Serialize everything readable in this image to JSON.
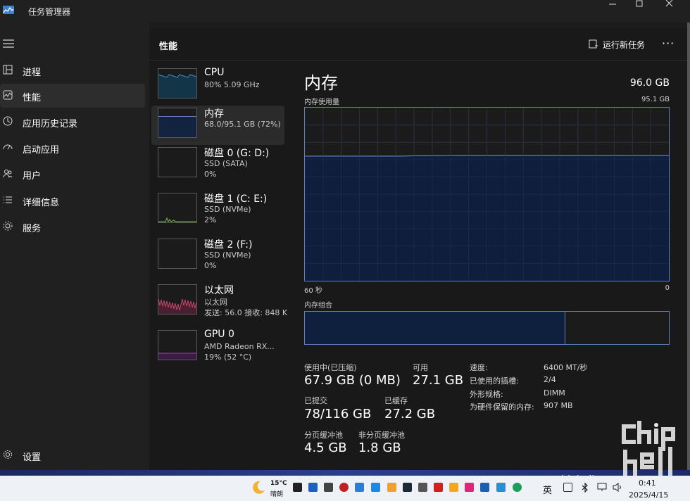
{
  "window": {
    "title": "任务管理器",
    "icons": [
      "app-icon",
      "minimize-icon",
      "maximize-icon",
      "close-icon"
    ]
  },
  "nav": {
    "items": [
      {
        "label": "进程",
        "icon": "processes-icon",
        "active": false
      },
      {
        "label": "性能",
        "icon": "performance-icon",
        "active": true
      },
      {
        "label": "应用历史记录",
        "icon": "app-history-icon",
        "active": false
      },
      {
        "label": "启动应用",
        "icon": "startup-icon",
        "active": false
      },
      {
        "label": "用户",
        "icon": "users-icon",
        "active": false
      },
      {
        "label": "详细信息",
        "icon": "details-icon",
        "active": false
      },
      {
        "label": "服务",
        "icon": "services-icon",
        "active": false
      }
    ],
    "settings_label": "设置"
  },
  "header": {
    "title": "性能",
    "run_task_label": "运行新任务",
    "more_label": "···"
  },
  "devices": [
    {
      "name": "CPU",
      "sub1": "80%  5.09 GHz",
      "sub2": "",
      "color": "#3a8fc7",
      "active": false
    },
    {
      "name": "内存",
      "sub1": "68.0/95.1 GB (72%)",
      "sub2": "",
      "color": "#5f7fbf",
      "active": true
    },
    {
      "name": "磁盘 0 (G: D:)",
      "sub1": "SSD (SATA)",
      "sub2": "0%",
      "color": "#6aa84f",
      "active": false
    },
    {
      "name": "磁盘 1 (C: E:)",
      "sub1": "SSD (NVMe)",
      "sub2": "2%",
      "color": "#6aa84f",
      "active": false
    },
    {
      "name": "磁盘 2 (F:)",
      "sub1": "SSD (NVMe)",
      "sub2": "0%",
      "color": "#6aa84f",
      "active": false
    },
    {
      "name": "以太网",
      "sub1": "以太网",
      "sub2": "发送: 56.0  接收: 848 K",
      "color": "#c04a6a",
      "active": false
    },
    {
      "name": "GPU 0",
      "sub1": "AMD Radeon RX...",
      "sub2": "19% (52 °C)",
      "color": "#9b3fb5",
      "active": false
    }
  ],
  "detail": {
    "title": "内存",
    "total": "96.0 GB",
    "usage_label": "内存使用量",
    "usage_max": "95.1 GB",
    "time_left": "60 秒",
    "time_right": "0",
    "composition_label": "内存组合",
    "composition_used_fraction": 0.715,
    "stats": {
      "in_use_label": "使用中(已压缩)",
      "in_use_value": "67.9 GB (0 MB)",
      "available_label": "可用",
      "available_value": "27.1 GB",
      "committed_label": "已提交",
      "committed_value": "78/116 GB",
      "cached_label": "已缓存",
      "cached_value": "27.2 GB",
      "paged_label": "分页缓冲池",
      "paged_value": "4.5 GB",
      "nonpaged_label": "非分页缓冲池",
      "nonpaged_value": "1.8 GB"
    },
    "props": [
      {
        "k": "速度:",
        "v": "6400 MT/秒"
      },
      {
        "k": "已使用的插槽:",
        "v": "2/4"
      },
      {
        "k": "外形规格:",
        "v": "DIMM"
      },
      {
        "k": "为硬件保留的内存:",
        "v": "907 MB"
      }
    ]
  },
  "chart_data": {
    "type": "area",
    "x_range_seconds": [
      60,
      0
    ],
    "y_range_gb": [
      0,
      95.1
    ],
    "values_percent": [
      72,
      72,
      72,
      72,
      72,
      72,
      72,
      72,
      72,
      72.2,
      72.2,
      72.3,
      72.4,
      72.4,
      72.4,
      72.4,
      72.4,
      72.4,
      72.4,
      72.4,
      72.4,
      72.4,
      72.4,
      72.4,
      72.4,
      72.4,
      72.4,
      72.4,
      72.4,
      72.4,
      72.4
    ]
  },
  "taskbar": {
    "weather_temp": "15°C",
    "weather_cond": "晴朗",
    "language": "英",
    "time": "0:41",
    "date": "2025/4/15",
    "site": "www.chiphell.com"
  }
}
